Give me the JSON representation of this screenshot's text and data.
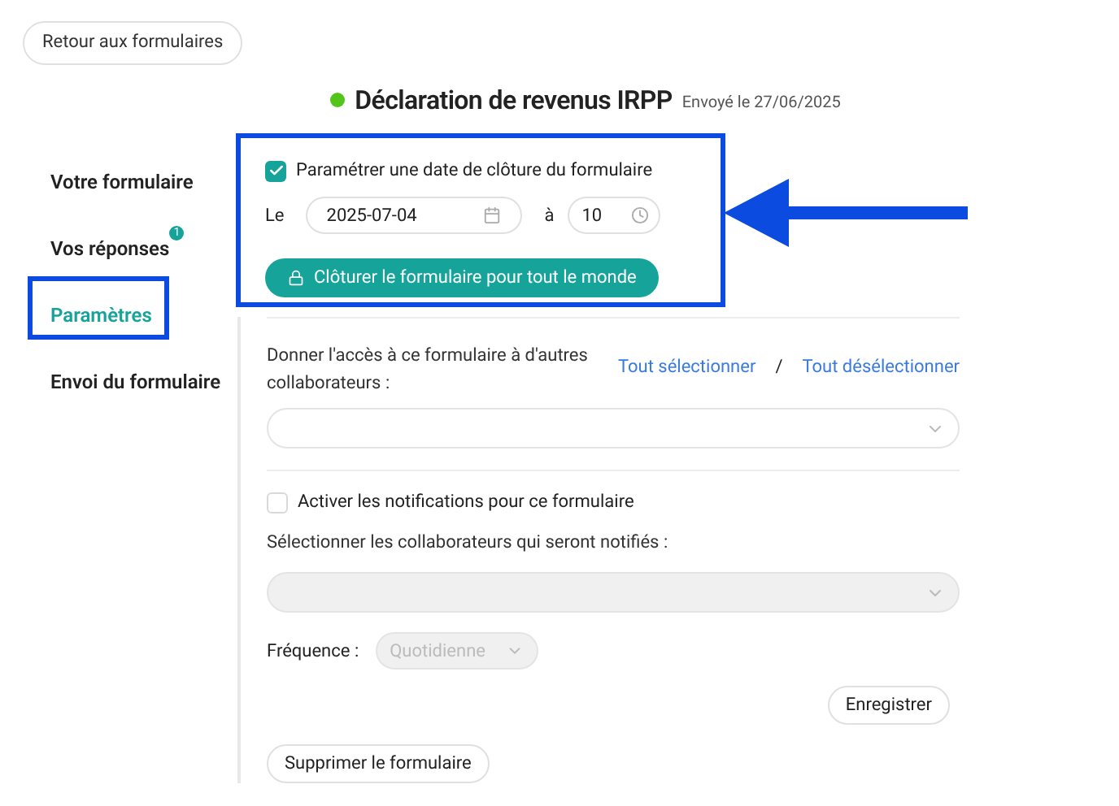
{
  "back_button": "Retour aux formulaires",
  "header": {
    "active": true,
    "title": "Déclaration de revenus IRPP",
    "sent": "Envoyé le 27/06/2025"
  },
  "sidebar": {
    "items": [
      {
        "label": "Votre formulaire",
        "selected": false
      },
      {
        "label": "Vos réponses",
        "selected": false,
        "badge": "1"
      },
      {
        "label": "Paramètres",
        "selected": true
      },
      {
        "label": "Envoi du formulaire",
        "selected": false
      }
    ]
  },
  "closing": {
    "checkbox": {
      "label": "Paramétrer une date de clôture du formulaire",
      "checked": true
    },
    "date_label": "Le",
    "date": "2025-07-04",
    "time_label": "à",
    "hour": "10",
    "button": "Clôturer le formulaire pour tout le monde"
  },
  "access": {
    "label": "Donner l'accès à ce formulaire à d'autres collaborateurs :",
    "select_all": "Tout sélectionner",
    "separator": "/",
    "deselect_all": "Tout désélectionner"
  },
  "notifications": {
    "checkbox": {
      "label": "Activer les notifications pour ce formulaire",
      "checked": false
    },
    "select_label": "Sélectionner les collaborateurs qui seront notifiés :",
    "frequency_label": "Fréquence :",
    "frequency": "Quotidienne",
    "disabled": true
  },
  "save_button": "Enregistrer",
  "delete_button": "Supprimer le formulaire"
}
